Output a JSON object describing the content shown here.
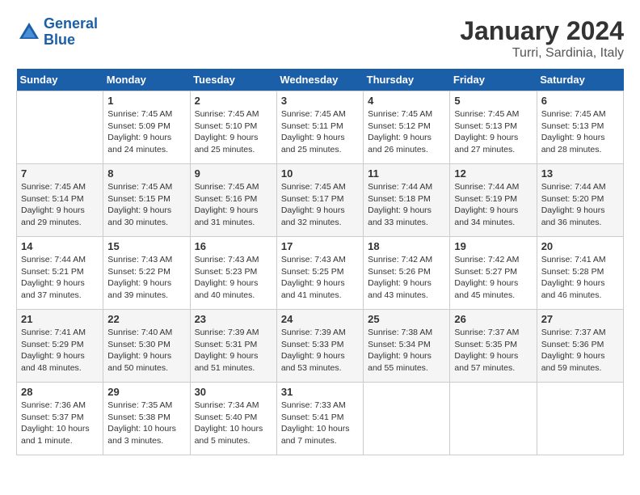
{
  "header": {
    "logo_line1": "General",
    "logo_line2": "Blue",
    "title": "January 2024",
    "subtitle": "Turri, Sardinia, Italy"
  },
  "days_of_week": [
    "Sunday",
    "Monday",
    "Tuesday",
    "Wednesday",
    "Thursday",
    "Friday",
    "Saturday"
  ],
  "weeks": [
    {
      "bg": "white",
      "days": [
        {
          "date": "",
          "info": ""
        },
        {
          "date": "1",
          "info": "Sunrise: 7:45 AM\nSunset: 5:09 PM\nDaylight: 9 hours\nand 24 minutes."
        },
        {
          "date": "2",
          "info": "Sunrise: 7:45 AM\nSunset: 5:10 PM\nDaylight: 9 hours\nand 25 minutes."
        },
        {
          "date": "3",
          "info": "Sunrise: 7:45 AM\nSunset: 5:11 PM\nDaylight: 9 hours\nand 25 minutes."
        },
        {
          "date": "4",
          "info": "Sunrise: 7:45 AM\nSunset: 5:12 PM\nDaylight: 9 hours\nand 26 minutes."
        },
        {
          "date": "5",
          "info": "Sunrise: 7:45 AM\nSunset: 5:13 PM\nDaylight: 9 hours\nand 27 minutes."
        },
        {
          "date": "6",
          "info": "Sunrise: 7:45 AM\nSunset: 5:13 PM\nDaylight: 9 hours\nand 28 minutes."
        }
      ]
    },
    {
      "bg": "light",
      "days": [
        {
          "date": "7",
          "info": "Sunrise: 7:45 AM\nSunset: 5:14 PM\nDaylight: 9 hours\nand 29 minutes."
        },
        {
          "date": "8",
          "info": "Sunrise: 7:45 AM\nSunset: 5:15 PM\nDaylight: 9 hours\nand 30 minutes."
        },
        {
          "date": "9",
          "info": "Sunrise: 7:45 AM\nSunset: 5:16 PM\nDaylight: 9 hours\nand 31 minutes."
        },
        {
          "date": "10",
          "info": "Sunrise: 7:45 AM\nSunset: 5:17 PM\nDaylight: 9 hours\nand 32 minutes."
        },
        {
          "date": "11",
          "info": "Sunrise: 7:44 AM\nSunset: 5:18 PM\nDaylight: 9 hours\nand 33 minutes."
        },
        {
          "date": "12",
          "info": "Sunrise: 7:44 AM\nSunset: 5:19 PM\nDaylight: 9 hours\nand 34 minutes."
        },
        {
          "date": "13",
          "info": "Sunrise: 7:44 AM\nSunset: 5:20 PM\nDaylight: 9 hours\nand 36 minutes."
        }
      ]
    },
    {
      "bg": "white",
      "days": [
        {
          "date": "14",
          "info": "Sunrise: 7:44 AM\nSunset: 5:21 PM\nDaylight: 9 hours\nand 37 minutes."
        },
        {
          "date": "15",
          "info": "Sunrise: 7:43 AM\nSunset: 5:22 PM\nDaylight: 9 hours\nand 39 minutes."
        },
        {
          "date": "16",
          "info": "Sunrise: 7:43 AM\nSunset: 5:23 PM\nDaylight: 9 hours\nand 40 minutes."
        },
        {
          "date": "17",
          "info": "Sunrise: 7:43 AM\nSunset: 5:25 PM\nDaylight: 9 hours\nand 41 minutes."
        },
        {
          "date": "18",
          "info": "Sunrise: 7:42 AM\nSunset: 5:26 PM\nDaylight: 9 hours\nand 43 minutes."
        },
        {
          "date": "19",
          "info": "Sunrise: 7:42 AM\nSunset: 5:27 PM\nDaylight: 9 hours\nand 45 minutes."
        },
        {
          "date": "20",
          "info": "Sunrise: 7:41 AM\nSunset: 5:28 PM\nDaylight: 9 hours\nand 46 minutes."
        }
      ]
    },
    {
      "bg": "light",
      "days": [
        {
          "date": "21",
          "info": "Sunrise: 7:41 AM\nSunset: 5:29 PM\nDaylight: 9 hours\nand 48 minutes."
        },
        {
          "date": "22",
          "info": "Sunrise: 7:40 AM\nSunset: 5:30 PM\nDaylight: 9 hours\nand 50 minutes."
        },
        {
          "date": "23",
          "info": "Sunrise: 7:39 AM\nSunset: 5:31 PM\nDaylight: 9 hours\nand 51 minutes."
        },
        {
          "date": "24",
          "info": "Sunrise: 7:39 AM\nSunset: 5:33 PM\nDaylight: 9 hours\nand 53 minutes."
        },
        {
          "date": "25",
          "info": "Sunrise: 7:38 AM\nSunset: 5:34 PM\nDaylight: 9 hours\nand 55 minutes."
        },
        {
          "date": "26",
          "info": "Sunrise: 7:37 AM\nSunset: 5:35 PM\nDaylight: 9 hours\nand 57 minutes."
        },
        {
          "date": "27",
          "info": "Sunrise: 7:37 AM\nSunset: 5:36 PM\nDaylight: 9 hours\nand 59 minutes."
        }
      ]
    },
    {
      "bg": "white",
      "days": [
        {
          "date": "28",
          "info": "Sunrise: 7:36 AM\nSunset: 5:37 PM\nDaylight: 10 hours\nand 1 minute."
        },
        {
          "date": "29",
          "info": "Sunrise: 7:35 AM\nSunset: 5:38 PM\nDaylight: 10 hours\nand 3 minutes."
        },
        {
          "date": "30",
          "info": "Sunrise: 7:34 AM\nSunset: 5:40 PM\nDaylight: 10 hours\nand 5 minutes."
        },
        {
          "date": "31",
          "info": "Sunrise: 7:33 AM\nSunset: 5:41 PM\nDaylight: 10 hours\nand 7 minutes."
        },
        {
          "date": "",
          "info": ""
        },
        {
          "date": "",
          "info": ""
        },
        {
          "date": "",
          "info": ""
        }
      ]
    }
  ]
}
